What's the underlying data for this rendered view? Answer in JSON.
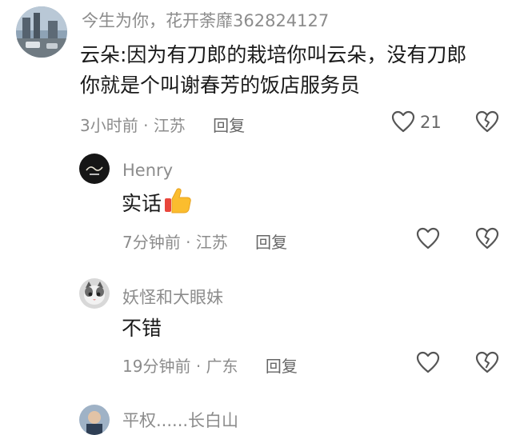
{
  "comments": [
    {
      "username": "今生为你，花开荼靡362824127",
      "text_line1": "云朵:因为有刀郎的栽培你叫云朵，没有刀郎",
      "text_line2": "你就是个叫谢春芳的饭店服务员",
      "time": "3小时前",
      "location": "江苏",
      "reply_label": "回复",
      "like_count": "21"
    },
    {
      "username": "Henry",
      "text": "实话",
      "time": "7分钟前",
      "location": "江苏",
      "reply_label": "回复"
    },
    {
      "username": "妖怪和大眼妹",
      "text": "不错",
      "time": "19分钟前",
      "location": "广东",
      "reply_label": "回复"
    },
    {
      "username": "平权......长白山"
    }
  ],
  "separator": "·",
  "icons": {
    "like": "heart-icon",
    "dislike": "broken-heart-icon",
    "thumbs_up_emoji": "thumbs-up-emoji"
  }
}
